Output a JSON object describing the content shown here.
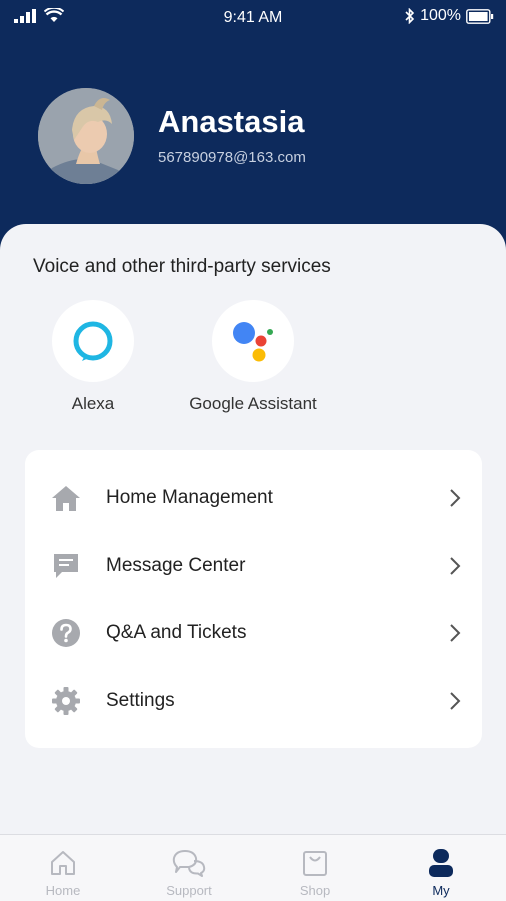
{
  "status_bar": {
    "time": "9:41 AM",
    "battery": "100%"
  },
  "profile": {
    "name": "Anastasia",
    "email": "567890978@163.com"
  },
  "services": {
    "title": "Voice and other third-party services",
    "items": [
      {
        "label": "Alexa",
        "icon": "alexa-icon"
      },
      {
        "label": "Google Assistant",
        "icon": "google-assistant-icon"
      }
    ]
  },
  "menu": {
    "items": [
      {
        "label": "Home Management",
        "icon": "home-icon"
      },
      {
        "label": "Message Center",
        "icon": "message-icon"
      },
      {
        "label": "Q&A and Tickets",
        "icon": "question-icon"
      },
      {
        "label": "Settings",
        "icon": "gear-icon"
      }
    ]
  },
  "tabs": [
    {
      "label": "Home",
      "icon": "home-outline-icon",
      "active": false
    },
    {
      "label": "Support",
      "icon": "chat-icon",
      "active": false
    },
    {
      "label": "Shop",
      "icon": "shop-bag-icon",
      "active": false
    },
    {
      "label": "My",
      "icon": "person-icon",
      "active": true
    }
  ],
  "colors": {
    "header": "#0d2a5c",
    "accent": "#0d2a5c",
    "icon_gray": "#a7a9ae",
    "alexa": "#1fb6e3"
  }
}
